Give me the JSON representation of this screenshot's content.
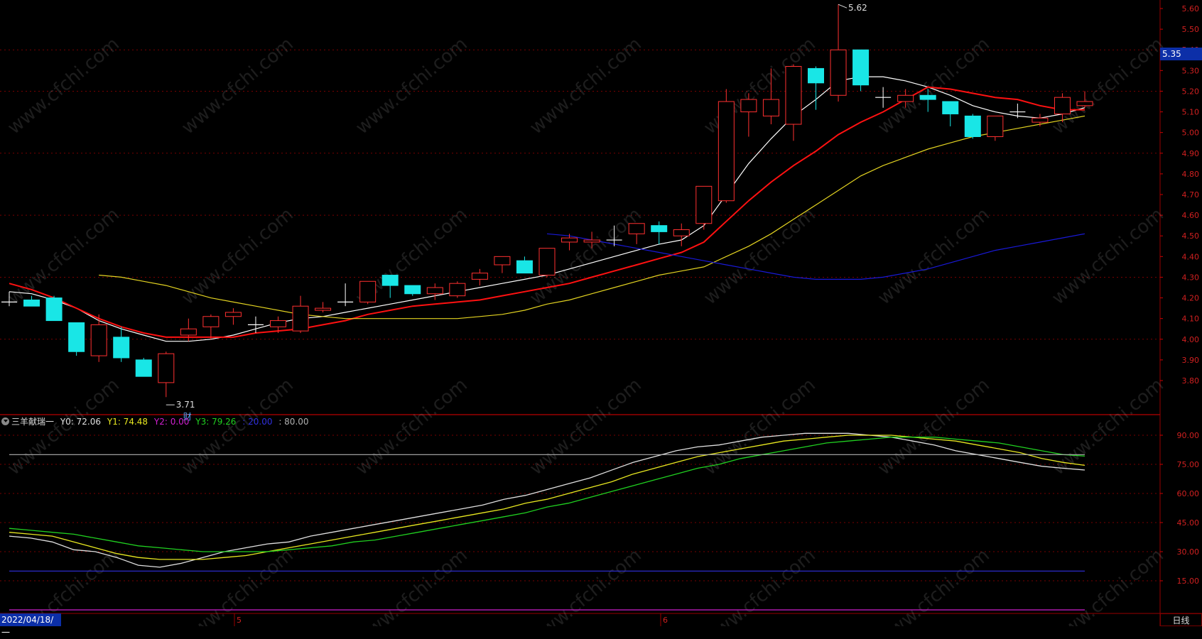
{
  "chart_data": [
    {
      "type": "candlestick",
      "y_ticks": [
        "5.60",
        "5.50",
        "5.40",
        "5.30",
        "5.20",
        "5.10",
        "5.00",
        "4.90",
        "4.80",
        "4.70",
        "4.60",
        "4.50",
        "4.40",
        "4.30",
        "4.20",
        "4.10",
        "4.00",
        "3.90",
        "3.80"
      ],
      "ylim": [
        3.66,
        5.65
      ],
      "current_price": "5.35",
      "annotations": {
        "high": "5.62",
        "low": "3.71",
        "event": "财"
      },
      "candles": [
        [
          4.18,
          4.23,
          4.16,
          4.18
        ],
        [
          4.19,
          4.21,
          4.16,
          4.16
        ],
        [
          4.2,
          4.21,
          4.09,
          4.09
        ],
        [
          4.08,
          4.08,
          3.92,
          3.94
        ],
        [
          3.92,
          4.12,
          3.89,
          4.07
        ],
        [
          4.01,
          4.06,
          3.89,
          3.91
        ],
        [
          3.9,
          3.91,
          3.82,
          3.82
        ],
        [
          3.79,
          3.94,
          3.72,
          3.93
        ],
        [
          4.02,
          4.1,
          3.99,
          4.05
        ],
        [
          4.06,
          4.12,
          4.0,
          4.11
        ],
        [
          4.11,
          4.15,
          4.07,
          4.13
        ],
        [
          4.07,
          4.11,
          4.03,
          4.07
        ],
        [
          4.06,
          4.11,
          4.03,
          4.09
        ],
        [
          4.04,
          4.21,
          4.03,
          4.16
        ],
        [
          4.14,
          4.18,
          4.13,
          4.15
        ],
        [
          4.18,
          4.27,
          4.16,
          4.18
        ],
        [
          4.18,
          4.28,
          4.17,
          4.28
        ],
        [
          4.31,
          4.31,
          4.2,
          4.26
        ],
        [
          4.26,
          4.25,
          4.21,
          4.22
        ],
        [
          4.22,
          4.27,
          4.19,
          4.25
        ],
        [
          4.21,
          4.28,
          4.2,
          4.27
        ],
        [
          4.29,
          4.34,
          4.26,
          4.32
        ],
        [
          4.36,
          4.4,
          4.32,
          4.4
        ],
        [
          4.38,
          4.4,
          4.32,
          4.32
        ],
        [
          4.31,
          4.44,
          4.3,
          4.44
        ],
        [
          4.47,
          4.51,
          4.43,
          4.49
        ],
        [
          4.47,
          4.52,
          4.44,
          4.48
        ],
        [
          4.48,
          4.55,
          4.45,
          4.48
        ],
        [
          4.51,
          4.56,
          4.46,
          4.56
        ],
        [
          4.55,
          4.57,
          4.46,
          4.52
        ],
        [
          4.5,
          4.56,
          4.45,
          4.53
        ],
        [
          4.56,
          4.74,
          4.53,
          4.74
        ],
        [
          4.67,
          5.21,
          4.66,
          5.15
        ],
        [
          5.1,
          5.19,
          4.98,
          5.16
        ],
        [
          5.08,
          5.31,
          5.04,
          5.16
        ],
        [
          5.04,
          5.33,
          4.96,
          5.32
        ],
        [
          5.31,
          5.32,
          5.11,
          5.24
        ],
        [
          5.18,
          5.62,
          5.15,
          5.4
        ],
        [
          5.4,
          5.4,
          5.2,
          5.23
        ],
        [
          5.17,
          5.22,
          5.12,
          5.17
        ],
        [
          5.15,
          5.21,
          5.12,
          5.18
        ],
        [
          5.18,
          5.21,
          5.1,
          5.16
        ],
        [
          5.15,
          5.15,
          5.03,
          5.09
        ],
        [
          5.08,
          5.09,
          4.97,
          4.98
        ],
        [
          4.98,
          5.08,
          4.96,
          5.08
        ],
        [
          5.1,
          5.14,
          5.07,
          5.1
        ],
        [
          5.05,
          5.09,
          5.03,
          5.07
        ],
        [
          5.09,
          5.19,
          5.05,
          5.17
        ],
        [
          5.13,
          5.2,
          5.12,
          5.15
        ]
      ],
      "ma_lines": [
        {
          "color": "#ffffff",
          "values": [
            4.23,
            4.22,
            4.19,
            4.15,
            4.09,
            4.05,
            4.02,
            3.99,
            3.99,
            4.0,
            4.02,
            4.05,
            4.08,
            4.1,
            4.11,
            4.13,
            4.15,
            4.17,
            4.19,
            4.21,
            4.23,
            4.25,
            4.27,
            4.29,
            4.31,
            4.34,
            4.37,
            4.4,
            4.43,
            4.46,
            4.48,
            4.55,
            4.7,
            4.85,
            4.97,
            5.08,
            5.16,
            5.25,
            5.27,
            5.27,
            5.25,
            5.22,
            5.18,
            5.13,
            5.1,
            5.08,
            5.07,
            5.09,
            5.12
          ]
        },
        {
          "color": "#ff1111",
          "values": [
            4.27,
            4.24,
            4.2,
            4.15,
            4.1,
            4.06,
            4.03,
            4.01,
            4.01,
            4.01,
            4.01,
            4.03,
            4.04,
            4.05,
            4.07,
            4.09,
            4.12,
            4.14,
            4.16,
            4.17,
            4.18,
            4.19,
            4.21,
            4.23,
            4.25,
            4.27,
            4.3,
            4.33,
            4.36,
            4.39,
            4.42,
            4.47,
            4.57,
            4.67,
            4.76,
            4.84,
            4.91,
            4.99,
            5.05,
            5.1,
            5.16,
            5.22,
            5.21,
            5.19,
            5.17,
            5.16,
            5.13,
            5.11,
            5.11
          ]
        },
        {
          "color": "#e3d321",
          "values": [
            4.31,
            4.3,
            4.28,
            4.26,
            4.23,
            4.2,
            4.18,
            4.16,
            4.14,
            4.12,
            4.11,
            4.1,
            4.1,
            4.1,
            4.1,
            4.1,
            4.1,
            4.11,
            4.12,
            4.14,
            4.17,
            4.19,
            4.22,
            4.25,
            4.28,
            4.31,
            4.33,
            4.35,
            4.4,
            4.45,
            4.51,
            4.58,
            4.65,
            4.72,
            4.79,
            4.84,
            4.88,
            4.92,
            4.95,
            4.98,
            5.0,
            5.02,
            5.04,
            5.06,
            5.08
          ]
        },
        {
          "color": "#1919d8",
          "values": [
            4.51,
            4.5,
            4.48,
            4.46,
            4.44,
            4.42,
            4.4,
            4.38,
            4.36,
            4.34,
            4.32,
            4.3,
            4.29,
            4.29,
            4.29,
            4.3,
            4.32,
            4.34,
            4.37,
            4.4,
            4.43,
            4.45,
            4.47,
            4.49,
            4.51
          ]
        }
      ]
    },
    {
      "type": "line",
      "legend": {
        "name": "三羊献瑞一",
        "items": [
          {
            "label": "Y0: 72.06",
            "color": "#e0e0e0"
          },
          {
            "label": "Y1: 74.48",
            "color": "#e8e820"
          },
          {
            "label": "Y2: 0.00",
            "color": "#d020d0"
          },
          {
            "label": "Y3: 79.26",
            "color": "#20d020"
          },
          {
            "label": ": 20.00",
            "color": "#3030e0"
          },
          {
            "label": ": 80.00",
            "color": "#b0b0b0"
          }
        ]
      },
      "y_ticks": [
        "90.00",
        "75.00",
        "60.00",
        "45.00",
        "30.00",
        "15.00"
      ],
      "ylim": [
        2,
        98
      ],
      "series": [
        {
          "name": "Y0",
          "color": "#e0e0e0",
          "values": [
            38,
            37,
            35,
            31,
            30,
            27,
            23,
            22,
            24,
            27,
            30,
            32,
            34,
            35,
            38,
            40,
            42,
            44,
            46,
            48,
            50,
            52,
            54,
            57,
            59,
            62,
            65,
            68,
            72,
            76,
            79,
            82,
            84,
            85,
            87,
            89,
            90,
            91,
            91,
            91,
            90,
            89,
            87,
            85,
            82,
            80,
            78,
            76,
            74,
            73,
            72.06
          ]
        },
        {
          "name": "Y1",
          "color": "#e8e820",
          "values": [
            40,
            39,
            38,
            35,
            32,
            29,
            27,
            26,
            26,
            26,
            27,
            28,
            30,
            32,
            34,
            36,
            38,
            40,
            42,
            44,
            46,
            48,
            50,
            52,
            55,
            57,
            60,
            63,
            66,
            70,
            73,
            76,
            79,
            81,
            83,
            85,
            87,
            88,
            89,
            90,
            90,
            90,
            89,
            88,
            87,
            85,
            83,
            81,
            78,
            76,
            74.48
          ]
        },
        {
          "name": "Y3",
          "color": "#20d020",
          "values": [
            42,
            41,
            40,
            39,
            37,
            35,
            33,
            32,
            31,
            30,
            30,
            30,
            30,
            31,
            32,
            33,
            35,
            36,
            38,
            40,
            42,
            44,
            46,
            48,
            50,
            53,
            55,
            58,
            61,
            64,
            67,
            70,
            73,
            75,
            78,
            80,
            82,
            84,
            86,
            87,
            88,
            89,
            89,
            89,
            88,
            87,
            86,
            84,
            82,
            80,
            79.26
          ]
        },
        {
          "name": "",
          "color": "#3030e0",
          "values": [
            20
          ]
        },
        {
          "name": "",
          "color": "#b0b0b0",
          "values": [
            80
          ]
        },
        {
          "name": "Y2",
          "color": "#d020d0",
          "values": [
            0
          ]
        }
      ]
    }
  ],
  "x_axis": {
    "start_date": "2022/04/18/一",
    "month_labels": [
      "5",
      "6"
    ]
  },
  "period_tab": "日线",
  "watermark": "www.cfchi.com"
}
